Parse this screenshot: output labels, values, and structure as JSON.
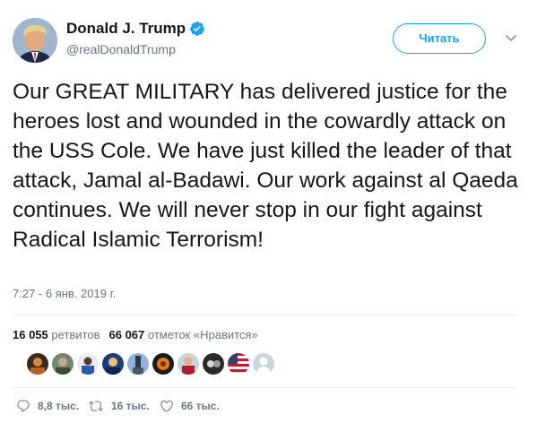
{
  "author": {
    "display_name": "Donald J. Trump",
    "handle": "@realDonaldTrump",
    "verified_icon": "verified-badge-icon",
    "avatar": "avatar-photo"
  },
  "follow_button": {
    "label": "Читать"
  },
  "menu": {
    "icon": "chevron-down-icon"
  },
  "tweet": {
    "text": "Our GREAT MILITARY has delivered justice for the heroes lost and wounded in the cowardly attack on the USS Cole. We have just killed the leader of that attack, Jamal al-Badawi. Our work against al Qaeda continues. We will never stop in our fight against Radical Islamic Terrorism!",
    "timestamp": "7:27 - 6 янв. 2019 г."
  },
  "stats": {
    "retweets_count": "16 055",
    "retweets_label": "ретвитов",
    "likes_count": "66 067",
    "likes_label": "отметок «Нравится»"
  },
  "likers": [
    {
      "name": "liker-avatar-1"
    },
    {
      "name": "liker-avatar-2"
    },
    {
      "name": "liker-avatar-3"
    },
    {
      "name": "liker-avatar-4"
    },
    {
      "name": "liker-avatar-5"
    },
    {
      "name": "liker-avatar-6"
    },
    {
      "name": "liker-avatar-7"
    },
    {
      "name": "liker-avatar-8"
    },
    {
      "name": "liker-avatar-9"
    },
    {
      "name": "liker-avatar-10"
    }
  ],
  "actions": {
    "reply_count": "8,8 тыс.",
    "retweet_count": "16 тыс.",
    "like_count": "66 тыс."
  },
  "colors": {
    "accent": "#1da1f2",
    "text": "#14171a",
    "secondary": "#657786",
    "divider": "#e6ecf0"
  }
}
